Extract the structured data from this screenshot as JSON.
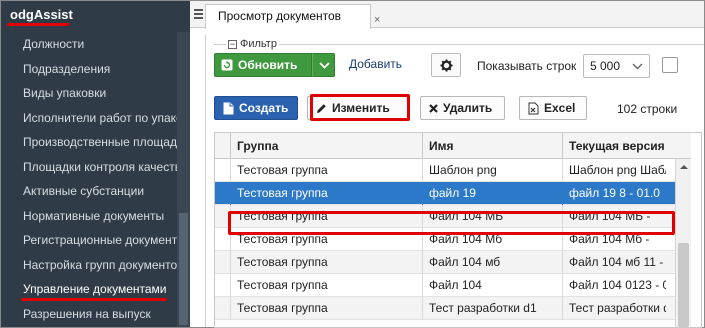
{
  "sidebar": {
    "brand": "odgAssist",
    "items": [
      {
        "label": "Должности"
      },
      {
        "label": "Подразделения"
      },
      {
        "label": "Виды упаковки"
      },
      {
        "label": "Исполнители работ по упако"
      },
      {
        "label": "Производственные площадк"
      },
      {
        "label": "Площадки контроля качеств"
      },
      {
        "label": "Активные субстанции"
      },
      {
        "label": "Нормативные документы"
      },
      {
        "label": "Регистрационные документы"
      },
      {
        "label": "Настройка групп документов"
      },
      {
        "label": "Управление документами"
      },
      {
        "label": "Разрешения на выпуск"
      }
    ]
  },
  "tab": {
    "title": "Просмотр документов",
    "close": "×"
  },
  "filter": {
    "legend": "Фильтр",
    "collapse_glyph": "−",
    "refresh_label": "Обновить",
    "add_label": "Добавить",
    "rows_label": "Показывать строк",
    "rows_value": "5 000"
  },
  "toolbar": {
    "create_label": "Создать",
    "edit_label": "Изменить",
    "delete_label": "Удалить",
    "excel_label": "Excel",
    "row_count": "102 строки"
  },
  "table": {
    "headers": [
      "Группа",
      "Имя",
      "Текущая версия"
    ],
    "rows": [
      {
        "group": "Тестовая группа",
        "name": "Шаблон png",
        "version": "Шаблон png Шабл"
      },
      {
        "group": "Тестовая группа",
        "name": "файл 19",
        "version": "файл 19 8 - 01.0"
      },
      {
        "group": "Тестовая группа",
        "name": "Файл 104 МБ",
        "version": "Файл 104 МБ -"
      },
      {
        "group": "Тестовая группа",
        "name": "Файл 104 Мб",
        "version": "Файл 104 Мб -"
      },
      {
        "group": "Тестовая группа",
        "name": "Файл 104 мб",
        "version": "Файл 104 мб 11 - 2"
      },
      {
        "group": "Тестовая группа",
        "name": "Файл 104",
        "version": "Файл 104 0123 - 0"
      },
      {
        "group": "Тестовая группа",
        "name": "Тест разработки d1",
        "version": "Тест разработки d"
      }
    ]
  },
  "colors": {
    "sidebar_bg": "#2f3b46",
    "accent_green": "#3f9a3f",
    "accent_blue": "#2a62b0",
    "selection": "#2b79c8",
    "highlight_red": "#e00000"
  }
}
